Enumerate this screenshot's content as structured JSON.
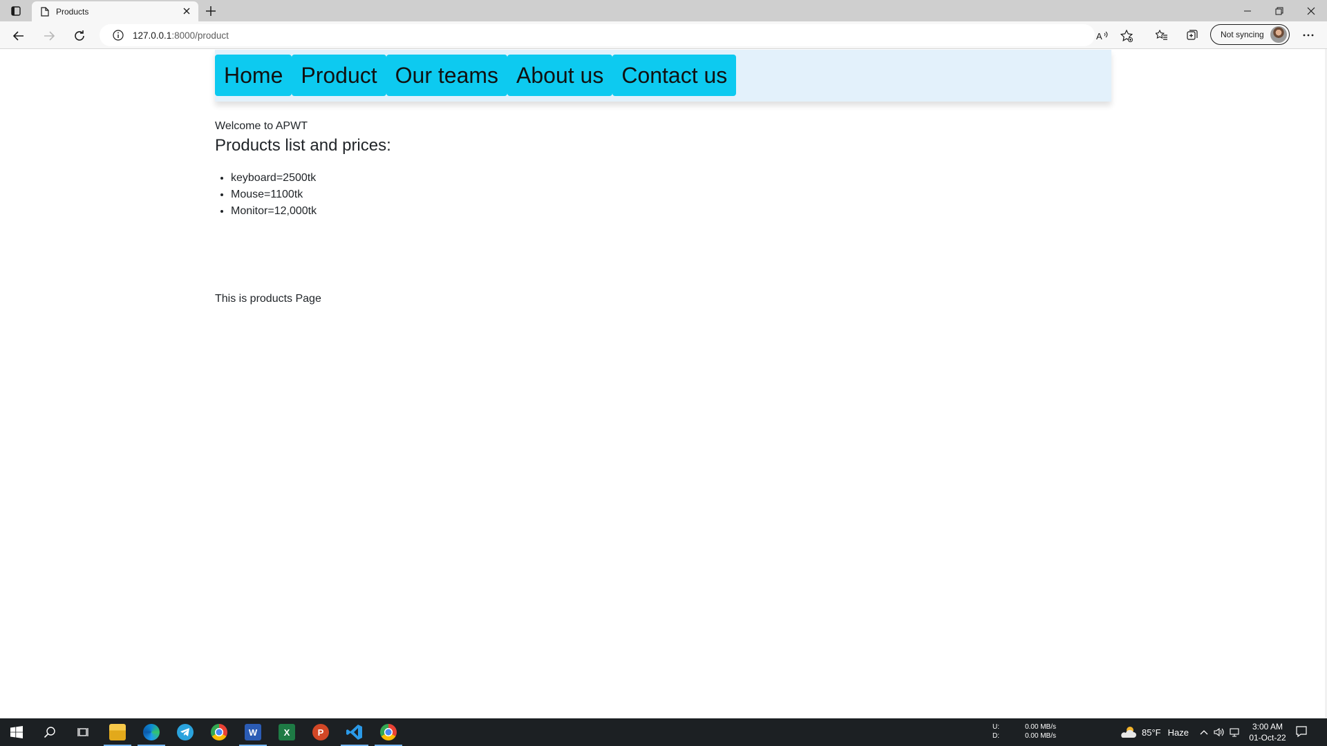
{
  "browser": {
    "tab": {
      "title": "Products"
    },
    "address": {
      "host": "127.0.0.1",
      "path": ":8000/product"
    },
    "profile": {
      "label": "Not syncing"
    }
  },
  "page": {
    "nav": [
      {
        "label": "Home"
      },
      {
        "label": "Product"
      },
      {
        "label": "Our teams"
      },
      {
        "label": "About us"
      },
      {
        "label": "Contact us"
      }
    ],
    "welcome": "Welcome to APWT",
    "heading": "Products list and prices:",
    "products": [
      {
        "text": "keyboard=2500tk"
      },
      {
        "text": "Mouse=1100tk"
      },
      {
        "text": "Monitor=12,000tk"
      }
    ],
    "footer": "This is products Page"
  },
  "taskbar": {
    "apps": [
      "windows-start",
      "search",
      "task-view",
      "file-explorer",
      "edge",
      "telegram",
      "chrome",
      "word",
      "excel",
      "powerpoint",
      "vscode",
      "chrome"
    ],
    "net": {
      "up_label": "U:",
      "down_label": "D:",
      "up": "0.00 MB/s",
      "down": "0.00 MB/s"
    },
    "weather": {
      "temp": "85°F",
      "condition": "Haze"
    },
    "clock": {
      "time": "3:00 AM",
      "date": "01-Oct-22"
    }
  },
  "colors": {
    "nav_button": "#0dcaf0",
    "navbar_bg": "#e3f1fb",
    "taskbar": "#1c2023"
  }
}
